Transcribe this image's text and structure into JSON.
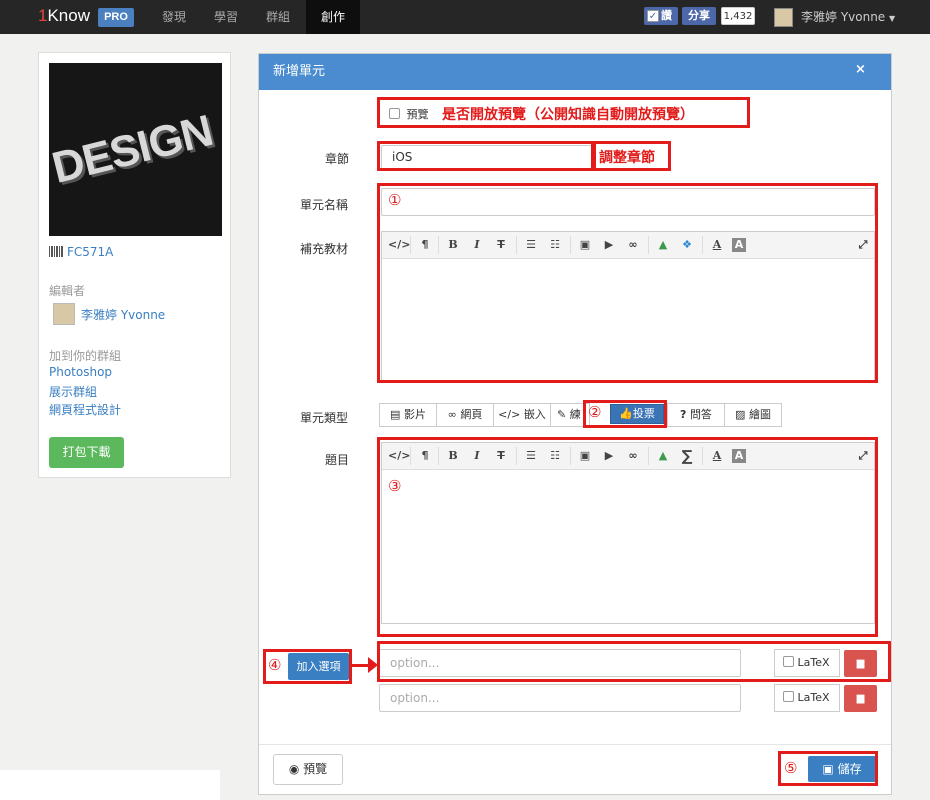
{
  "nav": {
    "logo_one": "1",
    "logo_text": "Know",
    "pro_badge": "PRO",
    "items": [
      {
        "label": "發現"
      },
      {
        "label": "學習"
      },
      {
        "label": "群組"
      },
      {
        "label": "創作"
      }
    ],
    "active_item": "創作",
    "fb_like": "讚",
    "fb_share": "分享",
    "fb_count": "1,432",
    "user_name": "李雅婷 Yvonne"
  },
  "sidebar": {
    "cover_text": "DESIGN",
    "code": "FC571A",
    "editor_label": "編輯者",
    "editor_name": "李雅婷 Yvonne",
    "groups_label": "加到你的群組",
    "groups": [
      "Photoshop",
      "展示群組",
      "網頁程式設計"
    ],
    "download_button": "打包下載"
  },
  "modal": {
    "title": "新增單元",
    "close": "×",
    "preview_checkbox": "預覽",
    "chapter_label": "章節",
    "chapter_value": "iOS",
    "unit_name_label": "單元名稱",
    "unit_name_value": "",
    "supplement_label": "補充教材",
    "unit_type_label": "單元類型",
    "unit_types": [
      {
        "label": "影片",
        "icon": "film-icon"
      },
      {
        "label": "網頁",
        "icon": "link-icon"
      },
      {
        "label": "嵌入",
        "icon": "code-icon"
      },
      {
        "label": "練",
        "icon": "edit-icon"
      },
      {
        "label": "投票",
        "icon": "thumbs-up-icon"
      },
      {
        "label": "問答",
        "icon": "question-icon"
      },
      {
        "label": "繪圖",
        "icon": "picture-icon"
      }
    ],
    "active_type": "投票",
    "question_label": "題目",
    "add_option_button": "加入選項",
    "options": [
      {
        "placeholder": "option...",
        "latex_label": "LaTeX"
      },
      {
        "placeholder": "option...",
        "latex_label": "LaTeX"
      }
    ],
    "preview_button": "預覽",
    "save_button": "儲存"
  },
  "annotations": {
    "preview_note": "是否開放預覽（公開知識自動開放預覽）",
    "chapter_note": "調整章節",
    "n1": "①",
    "n2": "②",
    "n3": "③",
    "n4": "④",
    "n5": "⑤"
  },
  "toolbar_icons": {
    "supplement": [
      "code-icon",
      "paragraph-icon",
      "bold-icon",
      "italic-icon",
      "strikethrough-icon",
      "unordered-list-icon",
      "ordered-list-icon",
      "image-icon",
      "video-icon",
      "link-icon",
      "google-drive-icon",
      "dropbox-icon",
      "font-color-icon",
      "background-color-icon",
      "fullscreen-icon"
    ],
    "question": [
      "code-icon",
      "paragraph-icon",
      "bold-icon",
      "italic-icon",
      "strikethrough-icon",
      "unordered-list-icon",
      "ordered-list-icon",
      "image-icon",
      "video-icon",
      "link-icon",
      "google-drive-icon",
      "sigma-icon",
      "font-color-icon",
      "background-color-icon",
      "fullscreen-icon"
    ]
  },
  "colors": {
    "navbar": "#262626",
    "modal_header": "#4a8ccf",
    "annotation_red": "#e21b1b",
    "primary": "#3a7fc1",
    "download_green": "#5cb85c",
    "delete_red": "#d9534f"
  }
}
